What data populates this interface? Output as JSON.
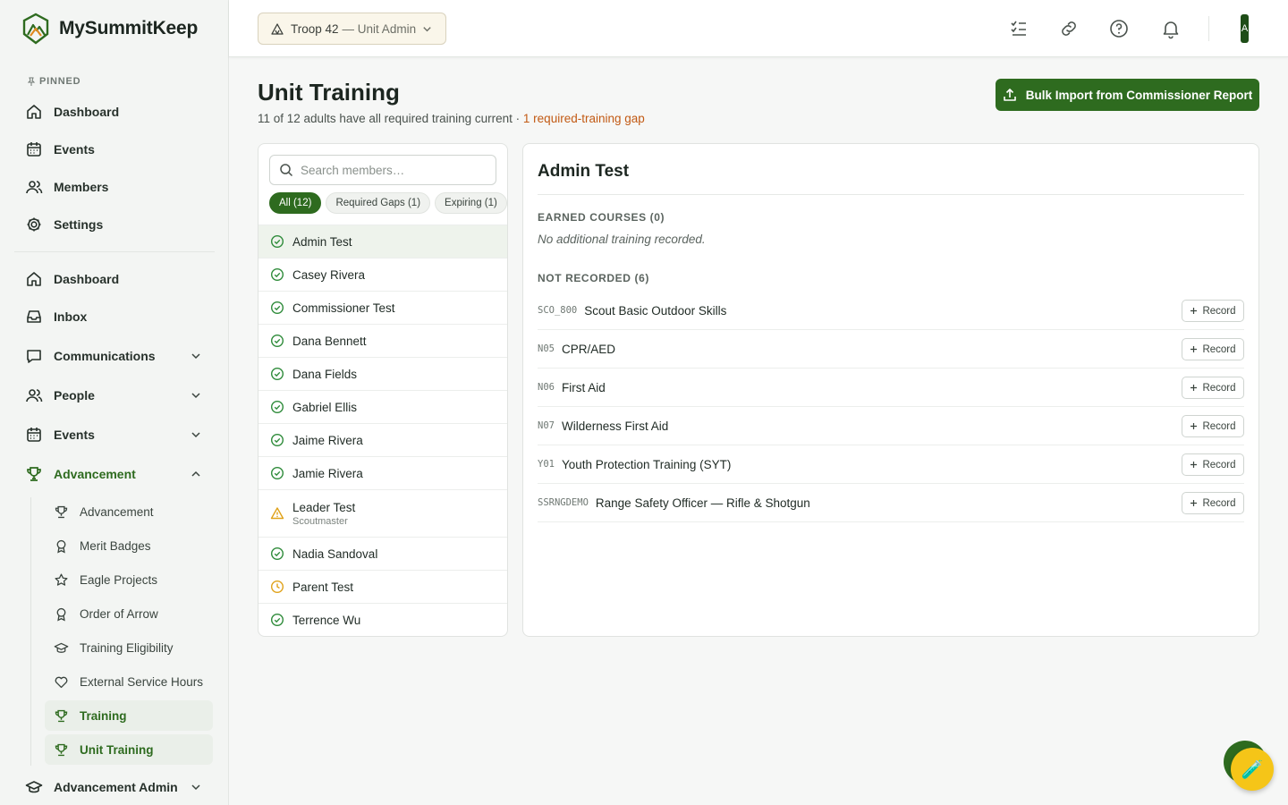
{
  "app": {
    "name": "MySummitKeep"
  },
  "sidebar": {
    "pinned_label": "PINNED",
    "pinned": [
      {
        "label": "Dashboard",
        "icon": "home-icon"
      },
      {
        "label": "Events",
        "icon": "calendar-icon"
      },
      {
        "label": "Members",
        "icon": "users-icon"
      },
      {
        "label": "Settings",
        "icon": "gear-icon"
      }
    ],
    "main": [
      {
        "label": "Dashboard",
        "icon": "home-icon"
      },
      {
        "label": "Inbox",
        "icon": "inbox-icon"
      },
      {
        "label": "Communications",
        "icon": "chat-icon"
      },
      {
        "label": "People",
        "icon": "users-icon"
      },
      {
        "label": "Events",
        "icon": "calendar-icon"
      },
      {
        "label": "Advancement",
        "icon": "trophy-icon"
      }
    ],
    "advancement_sub": [
      {
        "label": "Advancement",
        "icon": "trophy-icon"
      },
      {
        "label": "Merit Badges",
        "icon": "medal-icon"
      },
      {
        "label": "Eagle Projects",
        "icon": "star-icon"
      },
      {
        "label": "Order of Arrow",
        "icon": "medal-icon"
      },
      {
        "label": "Training Eligibility",
        "icon": "graduation-cap-icon"
      },
      {
        "label": "External Service Hours",
        "icon": "heart-icon"
      },
      {
        "label": "Training",
        "icon": "trophy-icon"
      },
      {
        "label": "Unit Training",
        "icon": "trophy-icon"
      }
    ],
    "advancement_admin": {
      "label": "Advancement Admin",
      "icon": "graduation-cap-icon"
    }
  },
  "topbar": {
    "unit_name": "Troop 42",
    "unit_role": "— Unit Admin",
    "avatar_initial": "A"
  },
  "page": {
    "title": "Unit Training",
    "summary": "11 of 12 adults have all required training current · ",
    "gap_text": "1 required-training gap",
    "bulk_button": "Bulk Import from Commissioner Report"
  },
  "members": {
    "search_placeholder": "Search members…",
    "filters": [
      "All (12)",
      "Required Gaps (1)",
      "Expiring (1)"
    ],
    "list": [
      {
        "name": "Admin Test",
        "status": "ok",
        "sub": ""
      },
      {
        "name": "Casey Rivera",
        "status": "ok",
        "sub": ""
      },
      {
        "name": "Commissioner Test",
        "status": "ok",
        "sub": ""
      },
      {
        "name": "Dana Bennett",
        "status": "ok",
        "sub": ""
      },
      {
        "name": "Dana Fields",
        "status": "ok",
        "sub": ""
      },
      {
        "name": "Gabriel Ellis",
        "status": "ok",
        "sub": ""
      },
      {
        "name": "Jaime Rivera",
        "status": "ok",
        "sub": ""
      },
      {
        "name": "Jamie Rivera",
        "status": "ok",
        "sub": ""
      },
      {
        "name": "Leader Test",
        "status": "warning",
        "sub": "Scoutmaster"
      },
      {
        "name": "Nadia Sandoval",
        "status": "ok",
        "sub": ""
      },
      {
        "name": "Parent Test",
        "status": "expiring",
        "sub": ""
      },
      {
        "name": "Terrence Wu",
        "status": "ok",
        "sub": ""
      }
    ]
  },
  "detail": {
    "name": "Admin Test",
    "earned_label": "EARNED COURSES (0)",
    "earned_empty": "No additional training recorded.",
    "not_recorded_label": "NOT RECORDED (6)",
    "record_label": "Record",
    "courses": [
      {
        "code": "SCO_800",
        "name": "Scout Basic Outdoor Skills"
      },
      {
        "code": "N05",
        "name": "CPR/AED"
      },
      {
        "code": "N06",
        "name": "First Aid"
      },
      {
        "code": "N07",
        "name": "Wilderness First Aid"
      },
      {
        "code": "Y01",
        "name": "Youth Protection Training (SYT)"
      },
      {
        "code": "SSRNGDEMO",
        "name": "Range Safety Officer — Rifle & Shotgun"
      }
    ]
  },
  "fab": {
    "icon": "test-tube-icon",
    "glyph": "🧪"
  },
  "colors": {
    "brand_green": "#2e6b1f",
    "warning_orange": "#c25a14",
    "fab_yellow": "#f5c518"
  }
}
